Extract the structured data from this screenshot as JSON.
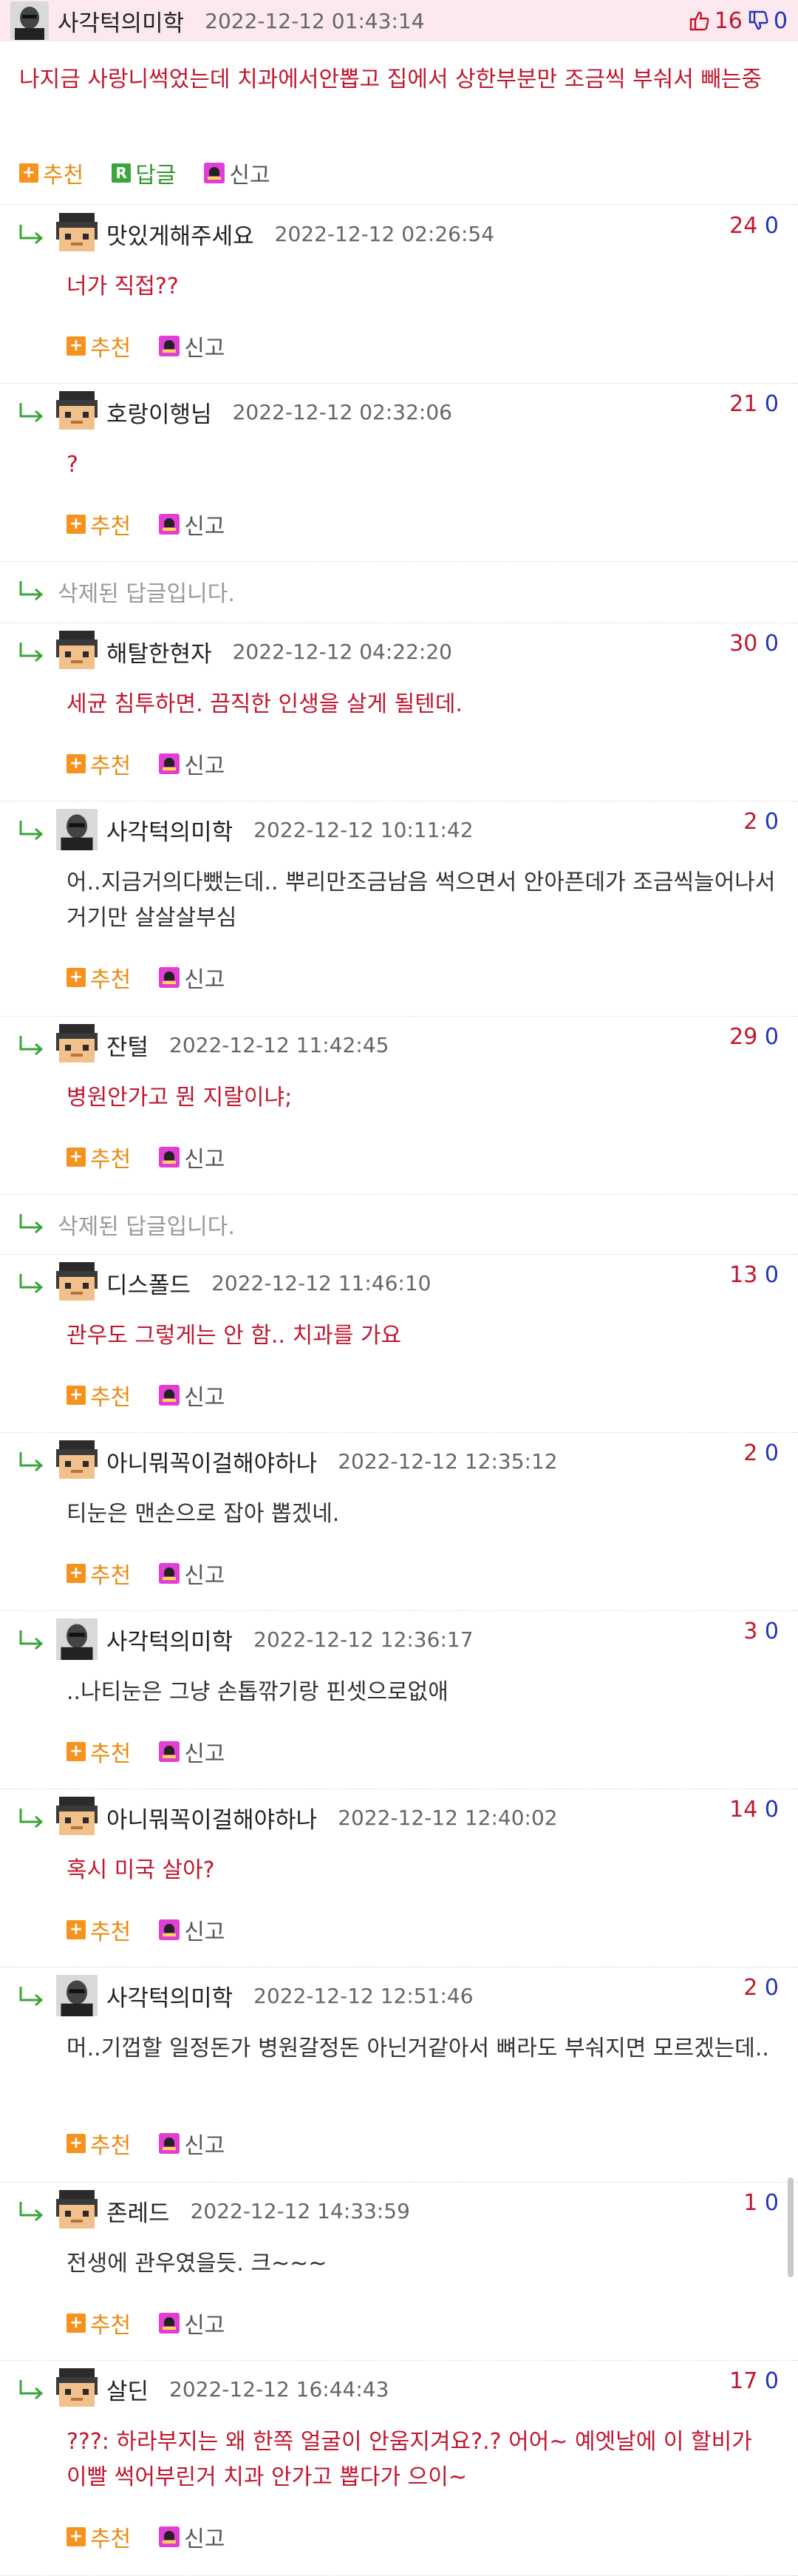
{
  "post": {
    "author": "사각턱의미학",
    "date": "2022-12-12 01:43:14",
    "up": "16",
    "down": "0",
    "text": "나지금 사랑니썩었는데 치과에서안뽑고 집에서 상한부분만 조금씩 부숴서 빼는중",
    "actions": {
      "recommend": "추천",
      "reply": "답글",
      "report": "신고"
    }
  },
  "comment_actions": {
    "recommend": "추천",
    "report": "신고"
  },
  "deleted_text": "삭제된 답글입니다.",
  "items": [
    {
      "kind": "comment",
      "author": "맛있게해주세요",
      "date": "2022-12-12 02:26:54",
      "up": "24",
      "down": "0",
      "text": "너가 직접??",
      "text_color": "red",
      "avatar": "pixel"
    },
    {
      "kind": "comment",
      "author": "호랑이행님",
      "date": "2022-12-12 02:32:06",
      "up": "21",
      "down": "0",
      "text": "?",
      "text_color": "red",
      "avatar": "pixel"
    },
    {
      "kind": "deleted"
    },
    {
      "kind": "comment",
      "author": "해탈한현자",
      "date": "2022-12-12 04:22:20",
      "up": "30",
      "down": "0",
      "text": "세균 침투하면. 끔직한 인생을 살게 될텐데.",
      "text_color": "red",
      "avatar": "pixel"
    },
    {
      "kind": "comment",
      "author": "사각턱의미학",
      "date": "2022-12-12 10:11:42",
      "up": "2",
      "down": "0",
      "text": "어..지금거의다뺐는데.. 뿌리만조금남음 썩으면서 안아픈데가 조금씩늘어나서 거기만 살살살부심",
      "text_color": "dark",
      "avatar": "photo"
    },
    {
      "kind": "comment",
      "author": "잔털",
      "date": "2022-12-12 11:42:45",
      "up": "29",
      "down": "0",
      "text": "병원안가고 뭔 지랄이냐;",
      "text_color": "red",
      "avatar": "pixel"
    },
    {
      "kind": "deleted"
    },
    {
      "kind": "comment",
      "author": "디스폴드",
      "date": "2022-12-12 11:46:10",
      "up": "13",
      "down": "0",
      "text": "관우도 그렇게는 안 함.. 치과를 가요",
      "text_color": "red",
      "avatar": "pixel"
    },
    {
      "kind": "comment",
      "author": "아니뭐꼭이걸해야하나",
      "date": "2022-12-12 12:35:12",
      "up": "2",
      "down": "0",
      "text": "티눈은 맨손으로 잡아 뽑겠네.",
      "text_color": "dark",
      "avatar": "pixel"
    },
    {
      "kind": "comment",
      "author": "사각턱의미학",
      "date": "2022-12-12 12:36:17",
      "up": "3",
      "down": "0",
      "text": "..나티눈은 그냥 손톱깎기랑 핀셋으로없애",
      "text_color": "dark",
      "avatar": "photo"
    },
    {
      "kind": "comment",
      "author": "아니뭐꼭이걸해야하나",
      "date": "2022-12-12 12:40:02",
      "up": "14",
      "down": "0",
      "text": "혹시 미국 살아?",
      "text_color": "red",
      "avatar": "pixel"
    },
    {
      "kind": "comment",
      "author": "사각턱의미학",
      "date": "2022-12-12 12:51:46",
      "up": "2",
      "down": "0",
      "text": "머..기껍할 일정돈가 병원갈정돈 아닌거같아서 뼈라도 부숴지면 모르겠는데..",
      "text_color": "dark",
      "avatar": "photo"
    },
    {
      "kind": "comment",
      "author": "존레드",
      "date": "2022-12-12 14:33:59",
      "up": "1",
      "down": "0",
      "text": "전생에 관우였을듯. 크~~~",
      "text_color": "dark",
      "avatar": "pixel"
    },
    {
      "kind": "comment",
      "author": "살딘",
      "date": "2022-12-12 16:44:43",
      "up": "17",
      "down": "0",
      "text": "???: 하라부지는 왜 한쪽 얼굴이 안움지겨요?.? 어어~ 예엣날에 이 할비가 이빨 썩어부린거 치과 안가고 뽑다가 으이~",
      "text_color": "red",
      "avatar": "pixel"
    }
  ],
  "colors": {
    "up": "#c0172f",
    "down": "#2233b8",
    "red_text": "#c0172f",
    "header_bg": "#fbe9ef"
  }
}
